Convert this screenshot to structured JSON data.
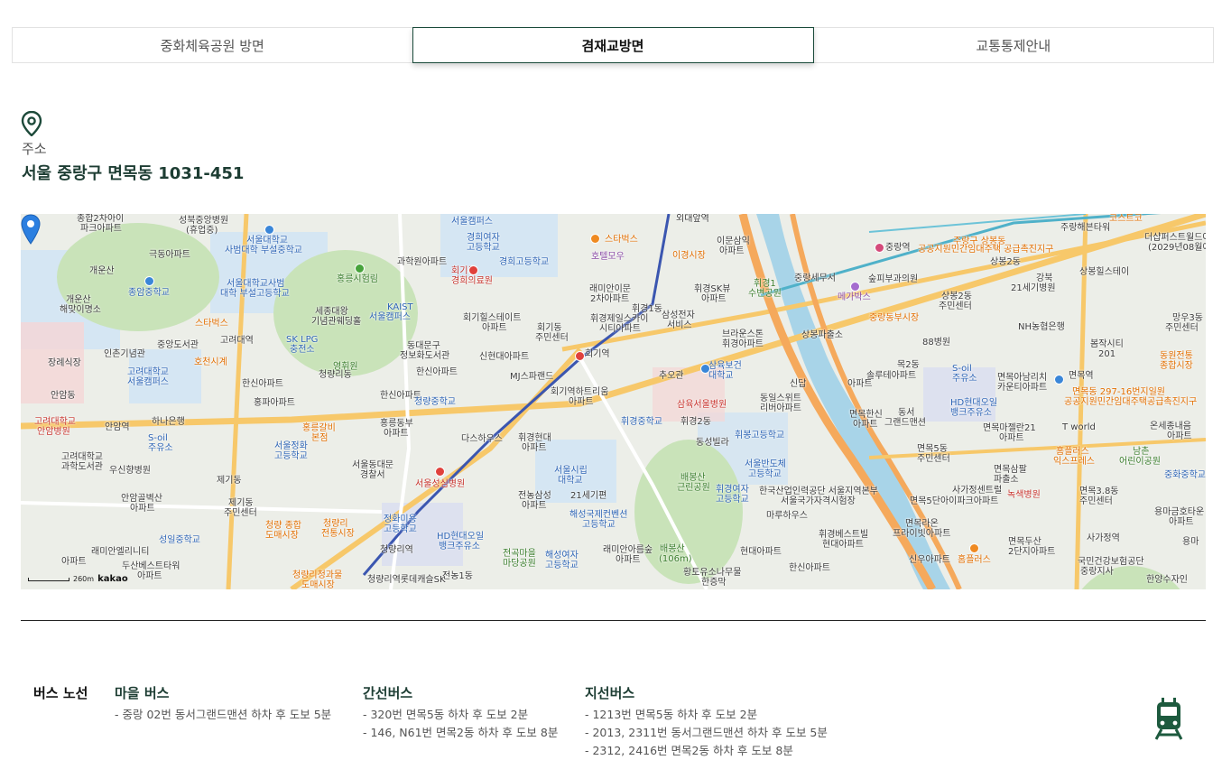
{
  "tabs": [
    {
      "label": "중화체육공원 방면",
      "active": false
    },
    {
      "label": "겸재교방면",
      "active": true
    },
    {
      "label": "교통통제안내",
      "active": false
    }
  ],
  "address": {
    "label": "주소",
    "value": "서울 중랑구 면목동 1031-451"
  },
  "map": {
    "scale_label": "260m",
    "provider": "kakao",
    "labels": [
      {
        "text": "종합2차아이",
        "t": ""
      },
      {
        "text": "파크아파트",
        "t": ""
      },
      {
        "text": "성북중앙병원",
        "t": ""
      },
      {
        "text": "(휴업중)",
        "t": ""
      },
      {
        "text": "극동아파트",
        "t": ""
      },
      {
        "text": "서울대학교",
        "t": "blue"
      },
      {
        "text": "사범대학 부설중학교",
        "t": "blue"
      },
      {
        "text": "개운산",
        "t": ""
      },
      {
        "text": "종암중학교",
        "t": "blue"
      },
      {
        "text": "서울대학교사범",
        "t": "blue"
      },
      {
        "text": "대학 부설고등학교",
        "t": "blue"
      },
      {
        "text": "개운산",
        "t": ""
      },
      {
        "text": "해맞이명소",
        "t": ""
      },
      {
        "text": "스타벅스",
        "t": "orange"
      },
      {
        "text": "세종대왕",
        "t": ""
      },
      {
        "text": "기념관웨딩홀",
        "t": ""
      },
      {
        "text": "고려대역",
        "t": ""
      },
      {
        "text": "중앙도서관",
        "t": ""
      },
      {
        "text": "인촌기념관",
        "t": ""
      },
      {
        "text": "장례식장",
        "t": ""
      },
      {
        "text": "호천시계",
        "t": "orange"
      },
      {
        "text": "고려대학교",
        "t": "blue"
      },
      {
        "text": "서울캠퍼스",
        "t": "blue"
      },
      {
        "text": "안암동",
        "t": ""
      },
      {
        "text": "고려대학교",
        "t": "red"
      },
      {
        "text": "안암병원",
        "t": "red"
      },
      {
        "text": "안암역",
        "t": ""
      },
      {
        "text": "하나은행",
        "t": ""
      },
      {
        "text": "S-oil",
        "t": "blue"
      },
      {
        "text": "주유소",
        "t": "blue"
      },
      {
        "text": "고려대학교",
        "t": ""
      },
      {
        "text": "과학도서관",
        "t": ""
      },
      {
        "text": "우신향병원",
        "t": ""
      },
      {
        "text": "안암골벽산",
        "t": ""
      },
      {
        "text": "아파트",
        "t": ""
      },
      {
        "text": "제기동",
        "t": ""
      },
      {
        "text": "제기동",
        "t": ""
      },
      {
        "text": "주민센터",
        "t": ""
      },
      {
        "text": "성일중학교",
        "t": "blue"
      },
      {
        "text": "래미안엘리니티",
        "t": ""
      },
      {
        "text": "아파트",
        "t": ""
      },
      {
        "text": "두산베스트타워",
        "t": ""
      },
      {
        "text": "아파트",
        "t": ""
      },
      {
        "text": "청량 종합",
        "t": "orange"
      },
      {
        "text": "도매시장",
        "t": "orange"
      },
      {
        "text": "청량리",
        "t": "orange"
      },
      {
        "text": "전통시장",
        "t": "orange"
      },
      {
        "text": "청량리청과물",
        "t": "orange"
      },
      {
        "text": "도매시장",
        "t": "orange"
      },
      {
        "text": "SK LPG",
        "t": "blue"
      },
      {
        "text": "충전소",
        "t": "blue"
      },
      {
        "text": "영휘원",
        "t": "green"
      },
      {
        "text": "청량리동",
        "t": ""
      },
      {
        "text": "한신아파트",
        "t": ""
      },
      {
        "text": "홍파아파트",
        "t": ""
      },
      {
        "text": "홍릉갈비",
        "t": "orange"
      },
      {
        "text": "본점",
        "t": "orange"
      },
      {
        "text": "서울정화",
        "t": "blue"
      },
      {
        "text": "고등학교",
        "t": "blue"
      },
      {
        "text": "서울동대문",
        "t": ""
      },
      {
        "text": "경찰서",
        "t": ""
      },
      {
        "text": "KAIST",
        "t": "blue"
      },
      {
        "text": "서울캠퍼스",
        "t": "blue"
      },
      {
        "text": "홍릉시험림",
        "t": "green"
      },
      {
        "text": "동대문구",
        "t": ""
      },
      {
        "text": "정보화도서관",
        "t": ""
      },
      {
        "text": "한신아파트",
        "t": ""
      },
      {
        "text": "한신아파트",
        "t": ""
      },
      {
        "text": "홍릉동부",
        "t": ""
      },
      {
        "text": "아파트",
        "t": ""
      },
      {
        "text": "청량중학교",
        "t": "blue"
      },
      {
        "text": "다스하우스",
        "t": ""
      },
      {
        "text": "서울성심병원",
        "t": "red"
      },
      {
        "text": "정화미용",
        "t": "blue"
      },
      {
        "text": "고등학교",
        "t": "blue"
      },
      {
        "text": "청량리역",
        "t": ""
      },
      {
        "text": "HD현대오일",
        "t": "blue"
      },
      {
        "text": "뱅크주유소",
        "t": "blue"
      },
      {
        "text": "청량리역롯데캐슬SK",
        "t": ""
      },
      {
        "text": "전농1동",
        "t": ""
      },
      {
        "text": "서울캠퍼스",
        "t": "blue"
      },
      {
        "text": "경희여자",
        "t": "blue"
      },
      {
        "text": "고등학교",
        "t": "blue"
      },
      {
        "text": "경희고등학교",
        "t": "blue"
      },
      {
        "text": "과학원아파트",
        "t": ""
      },
      {
        "text": "회기동",
        "t": "red"
      },
      {
        "text": "경희의료원",
        "t": "red"
      },
      {
        "text": "회기힐스테이트",
        "t": ""
      },
      {
        "text": "아파트",
        "t": ""
      },
      {
        "text": "신현대아파트",
        "t": ""
      },
      {
        "text": "MJ스파랜드",
        "t": ""
      },
      {
        "text": "회기역",
        "t": ""
      },
      {
        "text": "회기역하트리움",
        "t": ""
      },
      {
        "text": "아파트",
        "t": ""
      },
      {
        "text": "회기동",
        "t": ""
      },
      {
        "text": "주민센터",
        "t": ""
      },
      {
        "text": "휘경현대",
        "t": ""
      },
      {
        "text": "아파트",
        "t": ""
      },
      {
        "text": "서울시립",
        "t": "blue"
      },
      {
        "text": "대학교",
        "t": "blue"
      },
      {
        "text": "전농삼성",
        "t": ""
      },
      {
        "text": "아파트",
        "t": ""
      },
      {
        "text": "21세기편",
        "t": ""
      },
      {
        "text": "해성국제컨벤션",
        "t": "blue"
      },
      {
        "text": "고등학교",
        "t": "blue"
      },
      {
        "text": "전곡마을",
        "t": "green"
      },
      {
        "text": "마당공원",
        "t": "green"
      },
      {
        "text": "해성여자",
        "t": "blue"
      },
      {
        "text": "고등학교",
        "t": "blue"
      },
      {
        "text": "래미안아름숲",
        "t": ""
      },
      {
        "text": "아파트",
        "t": ""
      },
      {
        "text": "외대앞역",
        "t": ""
      },
      {
        "text": "스타벅스",
        "t": "orange"
      },
      {
        "text": "호텔모우",
        "t": "purple"
      },
      {
        "text": "이경시장",
        "t": "orange"
      },
      {
        "text": "래미안이문",
        "t": ""
      },
      {
        "text": "2차아파트",
        "t": ""
      },
      {
        "text": "휘경1동",
        "t": ""
      },
      {
        "text": "휘경제일스카이",
        "t": ""
      },
      {
        "text": "시티아파트",
        "t": ""
      },
      {
        "text": "삼성전자",
        "t": ""
      },
      {
        "text": "서비스",
        "t": ""
      },
      {
        "text": "휘경SK뷰",
        "t": ""
      },
      {
        "text": "아파트",
        "t": ""
      },
      {
        "text": "이문삼익",
        "t": ""
      },
      {
        "text": "아파트",
        "t": ""
      },
      {
        "text": "브라운스톤",
        "t": ""
      },
      {
        "text": "휘경아파트",
        "t": ""
      },
      {
        "text": "삼육보건",
        "t": "blue"
      },
      {
        "text": "대학교",
        "t": "blue"
      },
      {
        "text": "추오관",
        "t": ""
      },
      {
        "text": "삼육서울병원",
        "t": "red"
      },
      {
        "text": "휘경중학교",
        "t": "blue"
      },
      {
        "text": "휘경2동",
        "t": ""
      },
      {
        "text": "동성빌라",
        "t": ""
      },
      {
        "text": "동일스위트",
        "t": ""
      },
      {
        "text": "리버아파트",
        "t": ""
      },
      {
        "text": "휘봉고등학교",
        "t": "blue"
      },
      {
        "text": "서울반도체",
        "t": "blue"
      },
      {
        "text": "고등학교",
        "t": "blue"
      },
      {
        "text": "배봉산",
        "t": "green"
      },
      {
        "text": "근린공원",
        "t": "green"
      },
      {
        "text": "휘경여자",
        "t": "blue"
      },
      {
        "text": "고등학교",
        "t": "blue"
      },
      {
        "text": "한국산업인력공단 서울지역본부",
        "t": ""
      },
      {
        "text": "서울국가자격시험장",
        "t": ""
      },
      {
        "text": "마루하우스",
        "t": ""
      },
      {
        "text": "배봉산",
        "t": "green"
      },
      {
        "text": "(106m)",
        "t": "green"
      },
      {
        "text": "현대아파트",
        "t": ""
      },
      {
        "text": "휘경베스트빌",
        "t": ""
      },
      {
        "text": "현대아파트",
        "t": ""
      },
      {
        "text": "한신아파트",
        "t": ""
      },
      {
        "text": "황토유소나무물",
        "t": ""
      },
      {
        "text": "한증막",
        "t": ""
      },
      {
        "text": "중랑역",
        "t": ""
      },
      {
        "text": "중랑세무서",
        "t": ""
      },
      {
        "text": "메가박스",
        "t": "purple"
      },
      {
        "text": "중랑동부시장",
        "t": "orange"
      },
      {
        "text": "상봉파출소",
        "t": ""
      },
      {
        "text": "숲피부과의원",
        "t": ""
      },
      {
        "text": "88병원",
        "t": ""
      },
      {
        "text": "목2동",
        "t": ""
      },
      {
        "text": "솔루테아파트",
        "t": ""
      },
      {
        "text": "S-oil",
        "t": "blue"
      },
      {
        "text": "주유소",
        "t": "blue"
      },
      {
        "text": "면목한신",
        "t": ""
      },
      {
        "text": "아파트",
        "t": ""
      },
      {
        "text": "동서",
        "t": ""
      },
      {
        "text": "그랜드맨션",
        "t": ""
      },
      {
        "text": "HD현대오일",
        "t": "blue"
      },
      {
        "text": "뱅크주유소",
        "t": "blue"
      },
      {
        "text": "면목5동",
        "t": ""
      },
      {
        "text": "주민센터",
        "t": ""
      },
      {
        "text": "사가정센트럴",
        "t": ""
      },
      {
        "text": "면목5단아이파크아파트",
        "t": ""
      },
      {
        "text": "면목라온",
        "t": ""
      },
      {
        "text": "프라이빗아파트",
        "t": ""
      },
      {
        "text": "신우아파트",
        "t": ""
      },
      {
        "text": "홈플러스",
        "t": "orange"
      },
      {
        "text": "주랑구 상봉동",
        "t": "orange"
      },
      {
        "text": "공공지원민간임대주택 공급촉진지구",
        "t": "orange"
      },
      {
        "text": "상봉2동",
        "t": ""
      },
      {
        "text": "강북",
        "t": ""
      },
      {
        "text": "21세기병원",
        "t": ""
      },
      {
        "text": "상봉2동",
        "t": ""
      },
      {
        "text": "주민센터",
        "t": ""
      },
      {
        "text": "NH농협은행",
        "t": ""
      },
      {
        "text": "면목아남리치",
        "t": ""
      },
      {
        "text": "카운티아파트",
        "t": ""
      },
      {
        "text": "면목마젤란21",
        "t": ""
      },
      {
        "text": "아파트",
        "t": ""
      },
      {
        "text": "면목삼팔",
        "t": ""
      },
      {
        "text": "파출소",
        "t": ""
      },
      {
        "text": "녹색병원",
        "t": "red"
      },
      {
        "text": "면목두산",
        "t": ""
      },
      {
        "text": "2단지아파트",
        "t": ""
      },
      {
        "text": "주랑해븐타워",
        "t": ""
      },
      {
        "text": "코스트코",
        "t": "orange"
      },
      {
        "text": "더샵퍼스트월드아파트",
        "t": ""
      },
      {
        "text": "(2029년08월예정)",
        "t": ""
      },
      {
        "text": "상봉힐스테이",
        "t": ""
      },
      {
        "text": "망우3동",
        "t": ""
      },
      {
        "text": "주민센터",
        "t": ""
      },
      {
        "text": "봄작시티",
        "t": ""
      },
      {
        "text": "201",
        "t": ""
      },
      {
        "text": "동원전통",
        "t": "orange"
      },
      {
        "text": "종합시장",
        "t": "orange"
      },
      {
        "text": "면목역",
        "t": ""
      },
      {
        "text": "면목동 297-16번지일원",
        "t": "orange"
      },
      {
        "text": "공공지원민간임대주택공급촉진지구",
        "t": "orange"
      },
      {
        "text": "T world",
        "t": ""
      },
      {
        "text": "온세종내음",
        "t": ""
      },
      {
        "text": "아파트",
        "t": ""
      },
      {
        "text": "홈플러스",
        "t": "orange"
      },
      {
        "text": "익스프레스",
        "t": "orange"
      },
      {
        "text": "남촌",
        "t": "green"
      },
      {
        "text": "어린이공원",
        "t": "green"
      },
      {
        "text": "중화중학교",
        "t": "blue"
      },
      {
        "text": "면목3.8동",
        "t": ""
      },
      {
        "text": "주민센터",
        "t": ""
      },
      {
        "text": "용마금호타운",
        "t": ""
      },
      {
        "text": "아파트",
        "t": ""
      },
      {
        "text": "사가정역",
        "t": ""
      },
      {
        "text": "국민건강보험공단",
        "t": ""
      },
      {
        "text": "중랑지사",
        "t": ""
      },
      {
        "text": "한양수자인",
        "t": ""
      },
      {
        "text": "용마",
        "t": ""
      },
      {
        "text": "수변공원",
        "t": "green"
      },
      {
        "text": "휘경1",
        "t": "green"
      },
      {
        "text": "신답",
        "t": ""
      },
      {
        "text": "아파트",
        "t": ""
      }
    ]
  },
  "transit": {
    "title": "버스 노선",
    "groups": [
      {
        "name": "마을 버스",
        "lines": [
          "- 중랑 02번 동서그랜드맨션 하차 후 도보 5분"
        ]
      },
      {
        "name": "간선버스",
        "lines": [
          "- 320번 면목5동 하차 후 도보 2분",
          "- 146, N61번 면목2동 하차 후 도보 8분"
        ]
      },
      {
        "name": "지선버스",
        "lines": [
          "- 1213번 면목5동 하차 후 도보 2분",
          "- 2013, 2311번 동서그랜드맨션 하차 후 도보 5분",
          "- 2312, 2416번 면목2동 하차 후 도보 8분"
        ]
      }
    ]
  },
  "colors": {
    "accent": "#1d4a3a",
    "tab_border": "#1a4a3a",
    "river": "#a8d4e8",
    "road_major": "#f7c86a",
    "marker": "#2b7fe0"
  }
}
